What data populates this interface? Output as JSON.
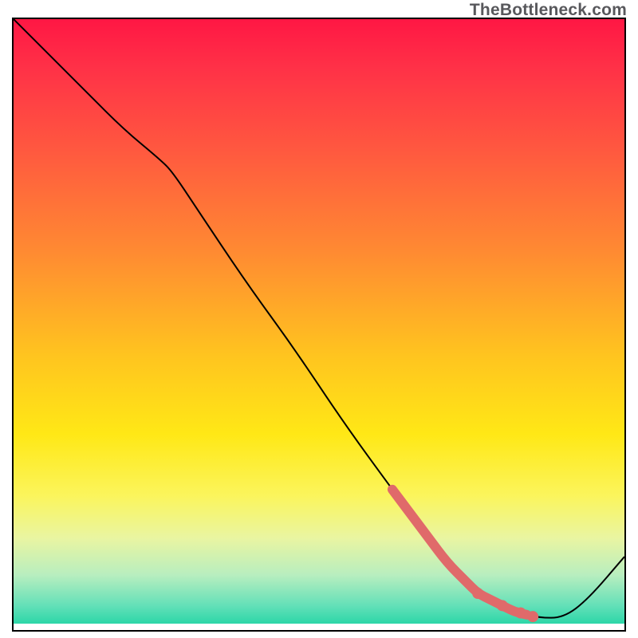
{
  "watermark": "TheBottleneck.com",
  "chart_data": {
    "type": "line",
    "title": "",
    "xlabel": "",
    "ylabel": "",
    "xlim": [
      0,
      100
    ],
    "ylim": [
      0,
      100
    ],
    "grid": false,
    "legend": false,
    "series": [
      {
        "name": "bottleneck-curve",
        "x": [
          0,
          6,
          12,
          18,
          24,
          26,
          30,
          38,
          46,
          54,
          62,
          68,
          74,
          78,
          82,
          86,
          90,
          94,
          100
        ],
        "y": [
          100,
          94,
          88,
          82,
          77,
          75,
          69,
          57,
          46,
          34,
          23,
          15,
          8,
          5,
          3,
          2,
          2,
          5,
          12
        ]
      }
    ],
    "highlight_segment": {
      "name": "thick-pink-segment",
      "color": "#e06a6a",
      "x": [
        62,
        65,
        68,
        71,
        74,
        76,
        78,
        80,
        82,
        84
      ],
      "y": [
        23,
        19,
        15,
        11,
        8,
        6,
        5,
        4,
        3,
        2.5
      ]
    },
    "highlight_points": [
      {
        "x": 76,
        "y": 6
      },
      {
        "x": 80,
        "y": 4
      },
      {
        "x": 83,
        "y": 2.8
      },
      {
        "x": 85,
        "y": 2.2
      }
    ]
  }
}
